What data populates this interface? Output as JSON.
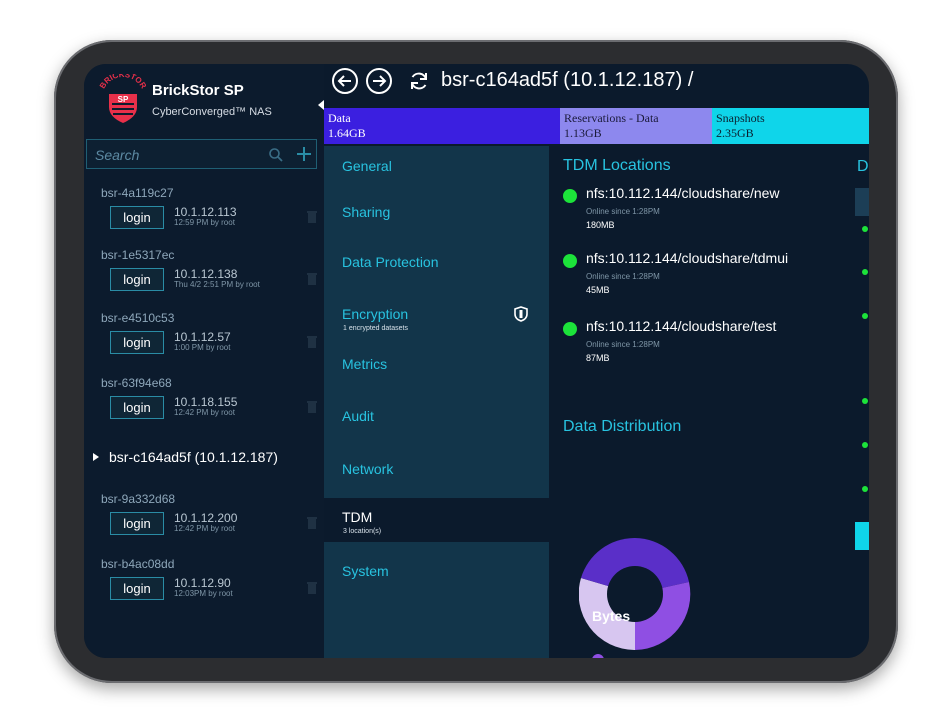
{
  "app": {
    "logo_text": "BRICKSTOR SP",
    "title": "BrickStor SP",
    "subtitle": "CyberConverged™ NAS"
  },
  "search": {
    "placeholder": "Search"
  },
  "login_label": "login",
  "servers": [
    {
      "name": "bsr-4a119c27",
      "ip": "10.1.12.113",
      "meta": "12:59 PM by root"
    },
    {
      "name": "bsr-1e5317ec",
      "ip": "10.1.12.138",
      "meta": "Thu 4/2 2:51 PM by root"
    },
    {
      "name": "bsr-e4510c53",
      "ip": "10.1.12.57",
      "meta": "1:00 PM by root"
    },
    {
      "name": "bsr-63f94e68",
      "ip": "10.1.18.155",
      "meta": "12:42 PM by root"
    },
    {
      "name": "bsr-9a332d68",
      "ip": "10.1.12.200",
      "meta": "12:42 PM by root"
    },
    {
      "name": "bsr-b4ac08dd",
      "ip": "10.1.12.90",
      "meta": "12:03PM by root"
    }
  ],
  "selected_server": "bsr-c164ad5f (10.1.12.187)",
  "header": {
    "path": "bsr-c164ad5f (10.1.12.187) /"
  },
  "storage": [
    {
      "label": "Data",
      "value": "1.64GB",
      "color": "#3b1fe0",
      "text_color": "#ffffff"
    },
    {
      "label": "Reservations - Data",
      "value": "1.13GB",
      "color": "#8d88ee",
      "text_color": "#1a1a3a"
    },
    {
      "label": "Snapshots",
      "value": "2.35GB",
      "color": "#0fd5ea",
      "text_color": "#0b2030"
    }
  ],
  "menu": {
    "general": "General",
    "sharing": "Sharing",
    "data_protection": "Data Protection",
    "encryption": "Encryption",
    "encryption_sub": "1 encrypted datasets",
    "metrics": "Metrics",
    "audit": "Audit",
    "network": "Network",
    "tdm": "TDM",
    "tdm_sub": "3 location(s)",
    "system": "System"
  },
  "tdm": {
    "title": "TDM Locations",
    "locations": [
      {
        "path": "nfs:10.112.144/cloudshare/new",
        "online": "Online since 1:28PM",
        "size": "180MB",
        "status_color": "#1ce33a"
      },
      {
        "path": "nfs:10.112.144/cloudshare/tdmui",
        "online": "Online since 1:28PM",
        "size": "45MB",
        "status_color": "#1ce33a"
      },
      {
        "path": "nfs:10.112.144/cloudshare/test",
        "online": "Online since 1:28PM",
        "size": "87MB",
        "status_color": "#1ce33a"
      }
    ]
  },
  "distribution": {
    "title": "Data Distribution",
    "bytes_label": "Bytes"
  },
  "right_column": {
    "title": "D"
  },
  "colors": {
    "accent": "#28c3e0",
    "background": "#0b1a2c",
    "menu_bg": "#12354a",
    "online": "#1ce33a"
  },
  "icons": [
    "back-arrow-icon",
    "forward-arrow-icon",
    "refresh-icon",
    "search-icon",
    "plus-icon",
    "shield-icon",
    "trash-icon"
  ]
}
